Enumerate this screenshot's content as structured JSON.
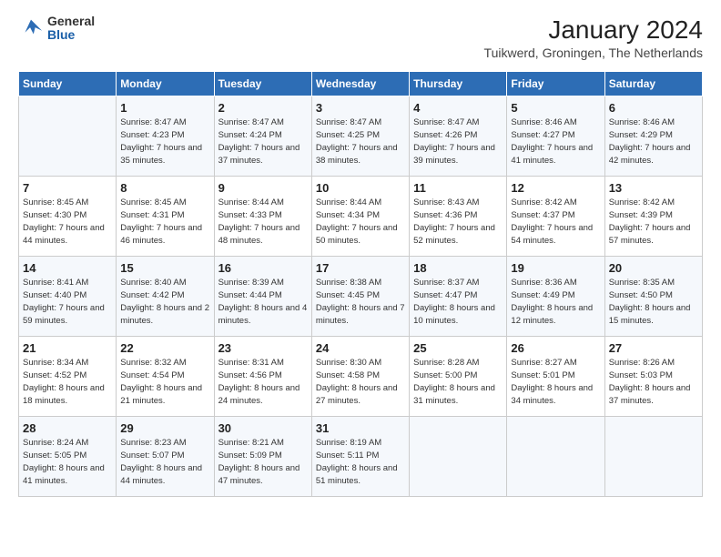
{
  "header": {
    "logo_line1": "General",
    "logo_line2": "Blue",
    "month_title": "January 2024",
    "location": "Tuikwerd, Groningen, The Netherlands"
  },
  "days_of_week": [
    "Sunday",
    "Monday",
    "Tuesday",
    "Wednesday",
    "Thursday",
    "Friday",
    "Saturday"
  ],
  "weeks": [
    [
      {
        "day": "",
        "sunrise": "",
        "sunset": "",
        "daylight": ""
      },
      {
        "day": "1",
        "sunrise": "8:47 AM",
        "sunset": "4:23 PM",
        "daylight": "7 hours and 35 minutes."
      },
      {
        "day": "2",
        "sunrise": "8:47 AM",
        "sunset": "4:24 PM",
        "daylight": "7 hours and 37 minutes."
      },
      {
        "day": "3",
        "sunrise": "8:47 AM",
        "sunset": "4:25 PM",
        "daylight": "7 hours and 38 minutes."
      },
      {
        "day": "4",
        "sunrise": "8:47 AM",
        "sunset": "4:26 PM",
        "daylight": "7 hours and 39 minutes."
      },
      {
        "day": "5",
        "sunrise": "8:46 AM",
        "sunset": "4:27 PM",
        "daylight": "7 hours and 41 minutes."
      },
      {
        "day": "6",
        "sunrise": "8:46 AM",
        "sunset": "4:29 PM",
        "daylight": "7 hours and 42 minutes."
      }
    ],
    [
      {
        "day": "7",
        "sunrise": "8:45 AM",
        "sunset": "4:30 PM",
        "daylight": "7 hours and 44 minutes."
      },
      {
        "day": "8",
        "sunrise": "8:45 AM",
        "sunset": "4:31 PM",
        "daylight": "7 hours and 46 minutes."
      },
      {
        "day": "9",
        "sunrise": "8:44 AM",
        "sunset": "4:33 PM",
        "daylight": "7 hours and 48 minutes."
      },
      {
        "day": "10",
        "sunrise": "8:44 AM",
        "sunset": "4:34 PM",
        "daylight": "7 hours and 50 minutes."
      },
      {
        "day": "11",
        "sunrise": "8:43 AM",
        "sunset": "4:36 PM",
        "daylight": "7 hours and 52 minutes."
      },
      {
        "day": "12",
        "sunrise": "8:42 AM",
        "sunset": "4:37 PM",
        "daylight": "7 hours and 54 minutes."
      },
      {
        "day": "13",
        "sunrise": "8:42 AM",
        "sunset": "4:39 PM",
        "daylight": "7 hours and 57 minutes."
      }
    ],
    [
      {
        "day": "14",
        "sunrise": "8:41 AM",
        "sunset": "4:40 PM",
        "daylight": "7 hours and 59 minutes."
      },
      {
        "day": "15",
        "sunrise": "8:40 AM",
        "sunset": "4:42 PM",
        "daylight": "8 hours and 2 minutes."
      },
      {
        "day": "16",
        "sunrise": "8:39 AM",
        "sunset": "4:44 PM",
        "daylight": "8 hours and 4 minutes."
      },
      {
        "day": "17",
        "sunrise": "8:38 AM",
        "sunset": "4:45 PM",
        "daylight": "8 hours and 7 minutes."
      },
      {
        "day": "18",
        "sunrise": "8:37 AM",
        "sunset": "4:47 PM",
        "daylight": "8 hours and 10 minutes."
      },
      {
        "day": "19",
        "sunrise": "8:36 AM",
        "sunset": "4:49 PM",
        "daylight": "8 hours and 12 minutes."
      },
      {
        "day": "20",
        "sunrise": "8:35 AM",
        "sunset": "4:50 PM",
        "daylight": "8 hours and 15 minutes."
      }
    ],
    [
      {
        "day": "21",
        "sunrise": "8:34 AM",
        "sunset": "4:52 PM",
        "daylight": "8 hours and 18 minutes."
      },
      {
        "day": "22",
        "sunrise": "8:32 AM",
        "sunset": "4:54 PM",
        "daylight": "8 hours and 21 minutes."
      },
      {
        "day": "23",
        "sunrise": "8:31 AM",
        "sunset": "4:56 PM",
        "daylight": "8 hours and 24 minutes."
      },
      {
        "day": "24",
        "sunrise": "8:30 AM",
        "sunset": "4:58 PM",
        "daylight": "8 hours and 27 minutes."
      },
      {
        "day": "25",
        "sunrise": "8:28 AM",
        "sunset": "5:00 PM",
        "daylight": "8 hours and 31 minutes."
      },
      {
        "day": "26",
        "sunrise": "8:27 AM",
        "sunset": "5:01 PM",
        "daylight": "8 hours and 34 minutes."
      },
      {
        "day": "27",
        "sunrise": "8:26 AM",
        "sunset": "5:03 PM",
        "daylight": "8 hours and 37 minutes."
      }
    ],
    [
      {
        "day": "28",
        "sunrise": "8:24 AM",
        "sunset": "5:05 PM",
        "daylight": "8 hours and 41 minutes."
      },
      {
        "day": "29",
        "sunrise": "8:23 AM",
        "sunset": "5:07 PM",
        "daylight": "8 hours and 44 minutes."
      },
      {
        "day": "30",
        "sunrise": "8:21 AM",
        "sunset": "5:09 PM",
        "daylight": "8 hours and 47 minutes."
      },
      {
        "day": "31",
        "sunrise": "8:19 AM",
        "sunset": "5:11 PM",
        "daylight": "8 hours and 51 minutes."
      },
      {
        "day": "",
        "sunrise": "",
        "sunset": "",
        "daylight": ""
      },
      {
        "day": "",
        "sunrise": "",
        "sunset": "",
        "daylight": ""
      },
      {
        "day": "",
        "sunrise": "",
        "sunset": "",
        "daylight": ""
      }
    ]
  ],
  "labels": {
    "sunrise_prefix": "Sunrise:",
    "sunset_prefix": "Sunset:",
    "daylight_prefix": "Daylight:"
  }
}
